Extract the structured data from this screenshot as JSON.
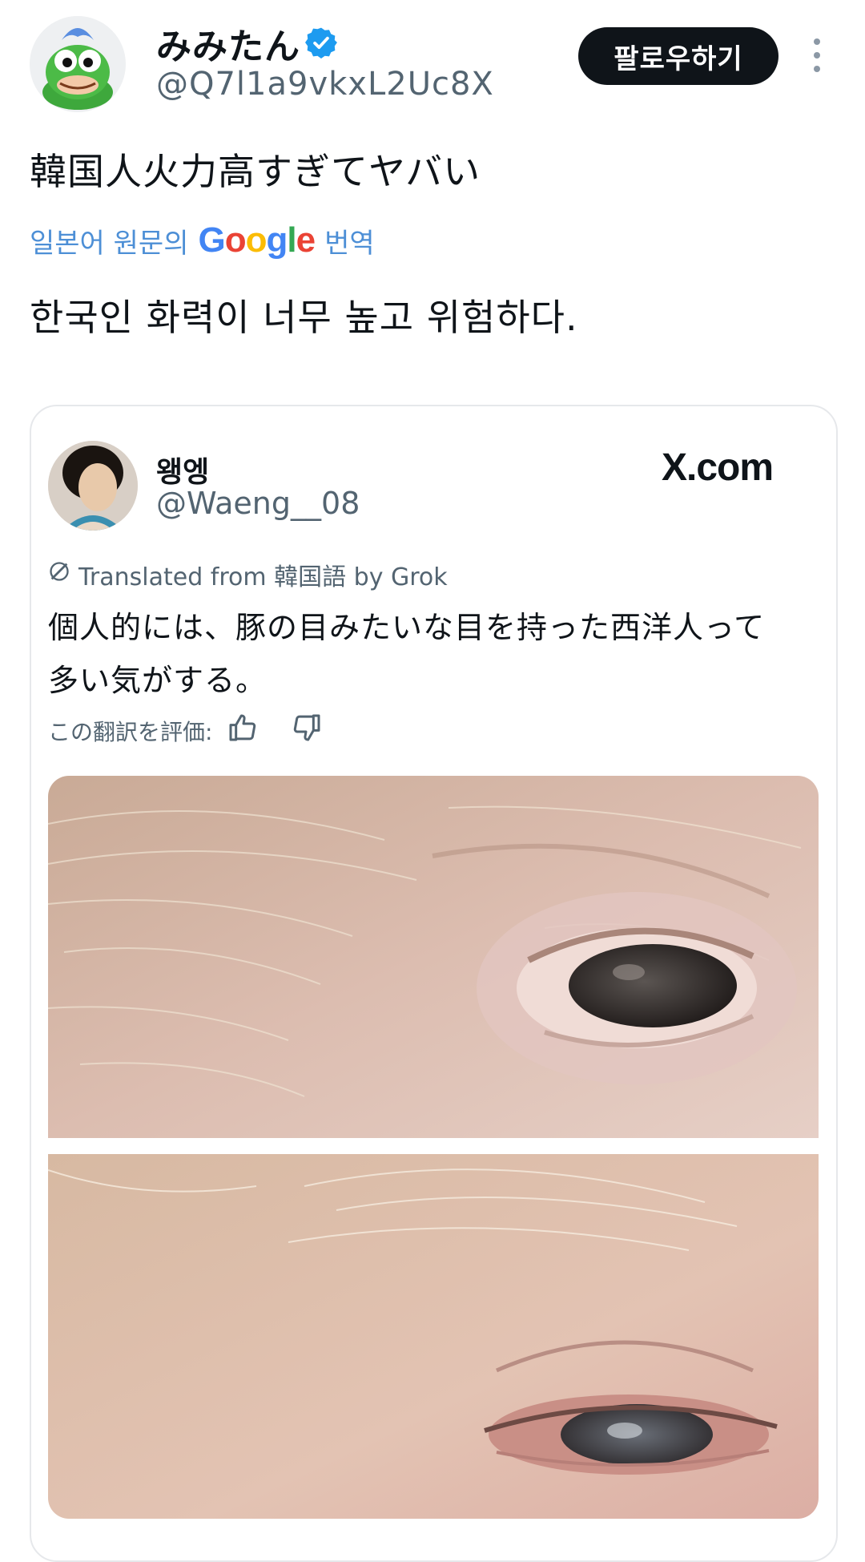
{
  "header": {
    "display_name": "みみたん",
    "handle": "@Q7l1a9vkxL2Uc8X",
    "follow_label": "팔로우하기"
  },
  "post": {
    "text": "韓国人火力高すぎてヤバい",
    "translate_prefix": "일본어 원문의",
    "translate_suffix": "번역",
    "translated_text": "한국인 화력이 너무 높고 위험하다."
  },
  "quote": {
    "name": "왱엥",
    "handle": "@Waeng__08",
    "source_logo": "X.com",
    "grok_note": "Translated from 韓国語 by Grok",
    "text_line1": "個人的には、豚の目みたいな目を持った西洋人って",
    "text_line2": "多い気がする。",
    "rate_label": "この翻訳を評価:"
  },
  "icons": {
    "verified": "verified-badge-icon",
    "more": "more-vertical-icon",
    "grok": "grok-icon",
    "thumbs_up": "thumbs-up-icon",
    "thumbs_down": "thumbs-down-icon"
  },
  "colors": {
    "accent_blue": "#1d9bf0",
    "translate_blue": "#4d8fd6",
    "text_secondary": "#536471"
  }
}
